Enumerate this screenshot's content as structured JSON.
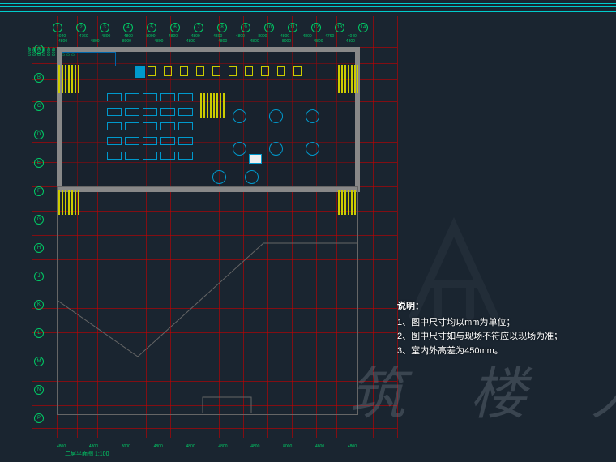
{
  "drawing": {
    "title_label": "二层平面图  1:100",
    "grid_axes_horizontal": [
      "1",
      "2",
      "3",
      "4",
      "5",
      "6",
      "7",
      "8",
      "9",
      "10",
      "11",
      "12",
      "13",
      "14"
    ],
    "grid_axes_vertical": [
      "A",
      "B",
      "C",
      "D",
      "E",
      "F",
      "G",
      "H",
      "J",
      "K",
      "L",
      "M",
      "N",
      "P"
    ],
    "dims_top_row1": [
      "4800",
      "4800",
      "8000",
      "4800",
      "4800",
      "4800",
      "4800",
      "8000",
      "4800",
      "4800"
    ],
    "dims_top_row2": [
      "4040",
      "4760",
      "4800",
      "4800",
      "8000",
      "4800",
      "4800",
      "4800",
      "4800",
      "8000",
      "4800",
      "4800",
      "4760",
      "4040"
    ],
    "dims_left": [
      "4800",
      "4800",
      "8000",
      "4800",
      "4800",
      "4800",
      "4800",
      "8000",
      "4800",
      "4800"
    ],
    "dims_bottom": [
      "4800",
      "4800",
      "8000",
      "4800",
      "4800",
      "4800",
      "4800",
      "8000",
      "4800",
      "4800"
    ]
  },
  "notes": {
    "heading": "说明：",
    "line1": "1、图中尺寸均以mm为单位；",
    "line2": "2、图中尺寸如与现场不符应以现场为准；",
    "line3": "3、室内外高差为450mm。"
  },
  "watermark": {
    "text": "筑 楼 人"
  },
  "furniture": {
    "round_tables_count": 8,
    "seating_rows": 5,
    "seating_cols": 5,
    "equipment_icons": 10
  },
  "chart_data": {
    "type": "table",
    "description": "CAD floor plan (second floor) with dimensioned structural grid",
    "unit": "mm",
    "grid": {
      "columns": [
        "1",
        "2",
        "3",
        "4",
        "5",
        "6",
        "7",
        "8",
        "9",
        "10",
        "11",
        "12",
        "13",
        "14"
      ],
      "rows": [
        "A",
        "B",
        "C",
        "D",
        "E",
        "F",
        "G",
        "H",
        "J",
        "K",
        "L",
        "M",
        "N",
        "P"
      ],
      "col_spacings_mm": [
        4800,
        4800,
        8000,
        4800,
        4800,
        4800,
        4800,
        8000,
        4800,
        4800
      ],
      "row_spacings_mm": [
        4800,
        4800,
        8000,
        4800,
        4800,
        4800,
        4800,
        8000,
        4800,
        4800
      ]
    },
    "elevation_diff_mm": 450,
    "scale": "1:100"
  }
}
